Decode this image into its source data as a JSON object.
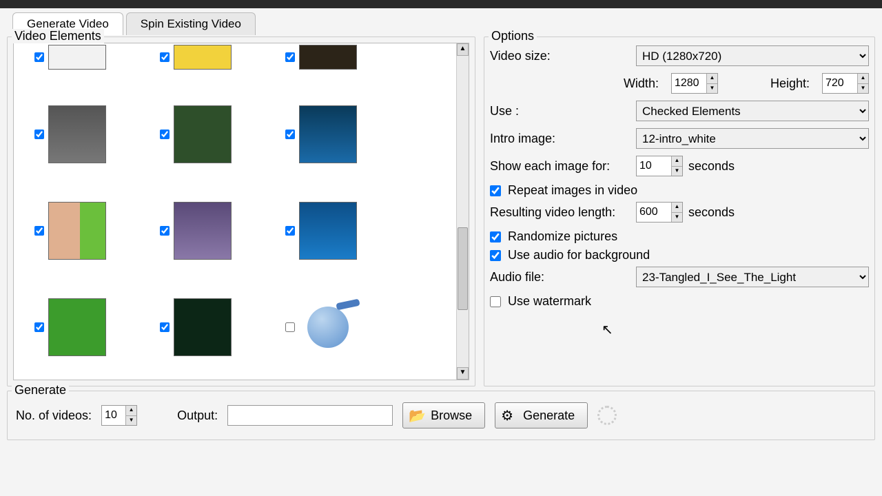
{
  "tabs": {
    "generate": "Generate Video",
    "spin": "Spin Existing Video"
  },
  "videoElements": {
    "title": "Video Elements"
  },
  "options": {
    "title": "Options",
    "video_size_label": "Video size:",
    "video_size_value": "HD (1280x720)",
    "width_label": "Width:",
    "width_value": "1280",
    "height_label": "Height:",
    "height_value": "720",
    "use_label": "Use :",
    "use_value": "Checked Elements",
    "intro_label": "Intro image:",
    "intro_value": "12-intro_white",
    "show_each_label": "Show each image for:",
    "show_each_value": "10",
    "seconds": "seconds",
    "repeat_label": "Repeat images in video",
    "length_label": "Resulting video length:",
    "length_value": "600",
    "randomize_label": "Randomize pictures",
    "use_audio_label": "Use audio for background",
    "audio_file_label": "Audio file:",
    "audio_file_value": "23-Tangled_I_See_The_Light",
    "watermark_label": "Use watermark"
  },
  "generate": {
    "title": "Generate",
    "no_videos_label": "No. of videos:",
    "no_videos_value": "10",
    "output_label": "Output:",
    "browse": "Browse",
    "generate": "Generate"
  }
}
